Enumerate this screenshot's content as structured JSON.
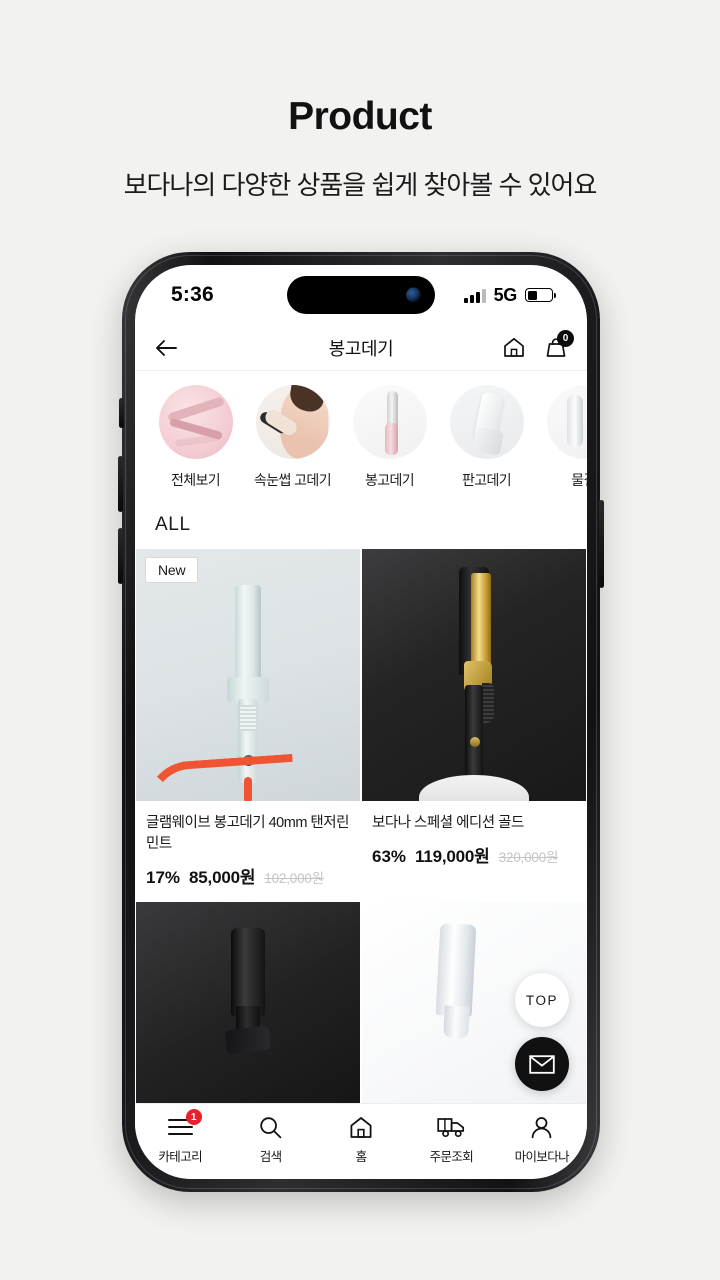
{
  "page": {
    "title": "Product",
    "subtitle": "보다나의 다양한 상품을 쉽게 찾아볼 수 있어요"
  },
  "status_bar": {
    "time": "5:36",
    "network": "5G",
    "signal_icon": "signal-bars-icon",
    "battery_icon": "battery-icon"
  },
  "app_header": {
    "back_icon": "back-arrow-icon",
    "title": "봉고데기",
    "home_icon": "home-icon",
    "cart_icon": "shopping-bag-icon",
    "cart_count": "0"
  },
  "categories": [
    {
      "label": "전체보기",
      "image": "pink-beauty-tools-collage"
    },
    {
      "label": "속눈썹 고데기",
      "image": "model-applying-makeup"
    },
    {
      "label": "봉고데기",
      "image": "pink-silver-curling-iron"
    },
    {
      "label": "판고데기",
      "image": "white-flat-iron"
    },
    {
      "label": "물결",
      "image": "wave-iron"
    }
  ],
  "section": {
    "all_label": "ALL"
  },
  "products": [
    {
      "badge": "New",
      "name": "글램웨이브 봉고데기 40mm 탠저린민트",
      "discount": "17%",
      "price": "85,000원",
      "original_price": "102,000원",
      "image": "mint-curling-iron-coral-cord"
    },
    {
      "badge": "",
      "name": "보다나 스페셜 에디션 골드",
      "discount": "63%",
      "price": "119,000원",
      "original_price": "320,000원",
      "image": "gold-black-curling-iron"
    },
    {
      "badge": "",
      "name": "",
      "discount": "",
      "price": "",
      "original_price": "",
      "image": "black-styler-dark-background"
    },
    {
      "badge": "",
      "name": "",
      "discount": "",
      "price": "",
      "original_price": "",
      "image": "white-styler-light-background"
    }
  ],
  "floating": {
    "top_label": "TOP",
    "mail_icon": "envelope-icon"
  },
  "bottom_nav": [
    {
      "label": "카테고리",
      "icon": "hamburger-menu-icon",
      "badge": "1"
    },
    {
      "label": "검색",
      "icon": "search-icon",
      "badge": ""
    },
    {
      "label": "홈",
      "icon": "home-icon",
      "badge": ""
    },
    {
      "label": "주문조회",
      "icon": "delivery-truck-icon",
      "badge": ""
    },
    {
      "label": "마이보다나",
      "icon": "person-icon",
      "badge": ""
    }
  ],
  "colors": {
    "background": "#f2f2f0",
    "accent_red": "#e8212b",
    "text_primary": "#111111"
  }
}
